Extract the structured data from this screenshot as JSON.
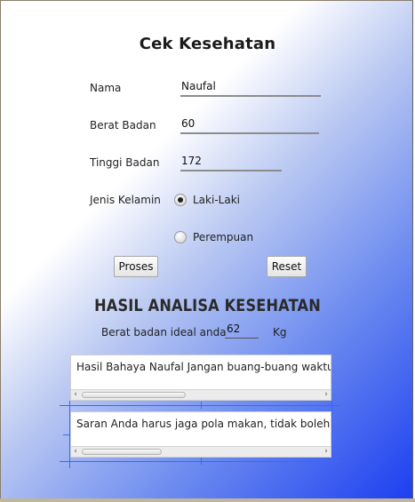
{
  "form": {
    "title": "Cek Kesehatan",
    "nama_label": "Nama",
    "nama_value": "Naufal",
    "berat_label": "Berat Badan",
    "berat_value": "60",
    "tinggi_label": "Tinggi Badan",
    "tinggi_value": "172",
    "gender_label": "Jenis Kelamin",
    "gender_options": [
      "Laki-Laki",
      "Perempuan"
    ],
    "gender_selected": "Laki-Laki",
    "proses_label": "Proses",
    "reset_label": "Reset"
  },
  "result": {
    "heading": "HASIL ANALISA KESEHATAN",
    "ideal_label": "Berat badan ideal anda",
    "ideal_value": "62",
    "ideal_unit": "Kg",
    "hasil_text": "Hasil Bahaya Naufal Jangan buang-buang waktu buat",
    "saran_text": "Saran Anda harus jaga pola makan, tidak boleh diet, p"
  },
  "colors": {
    "gradient_start": "#ffffff",
    "gradient_end": "#1c3ff0"
  }
}
